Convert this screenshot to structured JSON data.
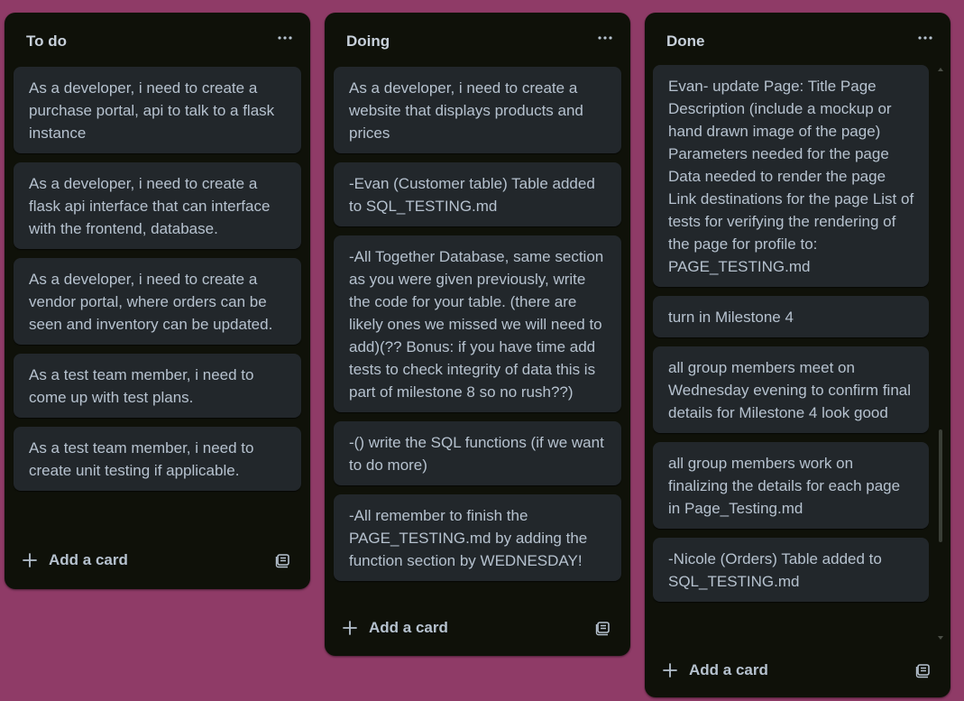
{
  "lists": [
    {
      "title": "To do",
      "cards": [
        "As a developer, i need to create a purchase portal, api to talk to a flask instance",
        "As a developer, i need to create a flask api interface that can interface with the frontend, database.",
        "As a developer, i need to create a vendor portal, where orders can be seen and inventory can be updated.",
        "As a test team member, i need to come up with test plans.",
        "As a test team member, i need to create unit testing if applicable."
      ],
      "add_card_label": "Add a card"
    },
    {
      "title": "Doing",
      "cards": [
        "As a developer, i need to create a website that displays products and prices",
        "-Evan (Customer table) Table added to SQL_TESTING.md",
        "-All Together Database, same section as you were given previously, write the code for your table. (there are likely ones we missed we will need to add)(?? Bonus: if you have time add tests to check integrity of data this is part of milestone 8 so no rush??)",
        "-() write the SQL functions (if we want to do more)",
        "-All remember to finish the PAGE_TESTING.md by adding the function section by WEDNESDAY!"
      ],
      "add_card_label": "Add a card"
    },
    {
      "title": "Done",
      "cards": [
        "Evan- update Page: Title Page Description (include a mockup or hand drawn image of the page) Parameters needed for the page Data needed to render the page Link destinations for the page List of tests for verifying the rendering of the page for profile to: PAGE_TESTING.md",
        "turn in Milestone 4",
        "all group members meet on Wednesday evening to confirm final details for Milestone 4 look good",
        "all group members work on finalizing the details for each page in Page_Testing.md",
        "-Nicole (Orders) Table added to SQL_TESTING.md"
      ],
      "add_card_label": "Add a card",
      "scroll_position": 0.75
    }
  ],
  "icons": {
    "menu": "ellipsis-icon",
    "add": "plus-icon",
    "template": "card-template-icon"
  },
  "colors": {
    "board_background": "#8f3b67",
    "list_background": "#0f1109",
    "card_background": "#22272b",
    "text": "#b6c2cf"
  }
}
